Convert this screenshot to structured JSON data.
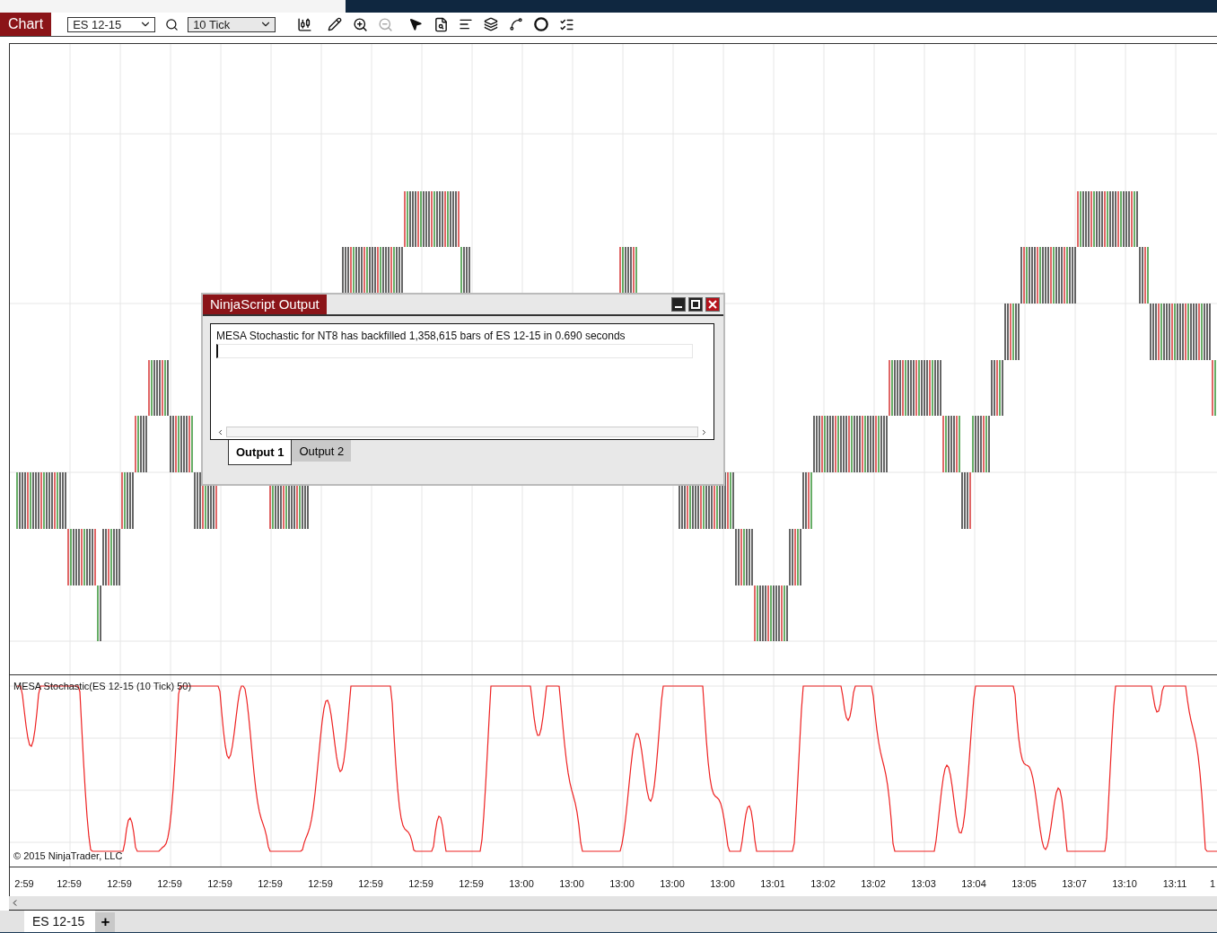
{
  "toolbar": {
    "title": "Chart",
    "instrument": "ES 12-15",
    "interval": "10 Tick"
  },
  "dialog": {
    "title": "NinjaScript Output",
    "message": "MESA Stochastic for NT8 has backfilled 1,358,615 bars of ES 12-15 in 0.690 seconds",
    "tabs": [
      {
        "label": "Output 1",
        "selected": true
      },
      {
        "label": "Output 2",
        "selected": false
      }
    ]
  },
  "indicator": {
    "label": "MESA Stochastic(ES 12-15 (10 Tick) 50)",
    "copyright": "© 2015 NinjaTrader, LLC"
  },
  "time_axis": [
    "2:59",
    "12:59",
    "12:59",
    "12:59",
    "12:59",
    "12:59",
    "12:59",
    "12:59",
    "12:59",
    "12:59",
    "13:00",
    "13:00",
    "13:00",
    "13:00",
    "13:00",
    "13:01",
    "13:02",
    "13:02",
    "13:03",
    "13:04",
    "13:05",
    "13:07",
    "13:10",
    "13:11",
    "1"
  ],
  "tabs": [
    {
      "label": "ES 12-15",
      "selected": true
    }
  ],
  "add_tab": "+"
}
